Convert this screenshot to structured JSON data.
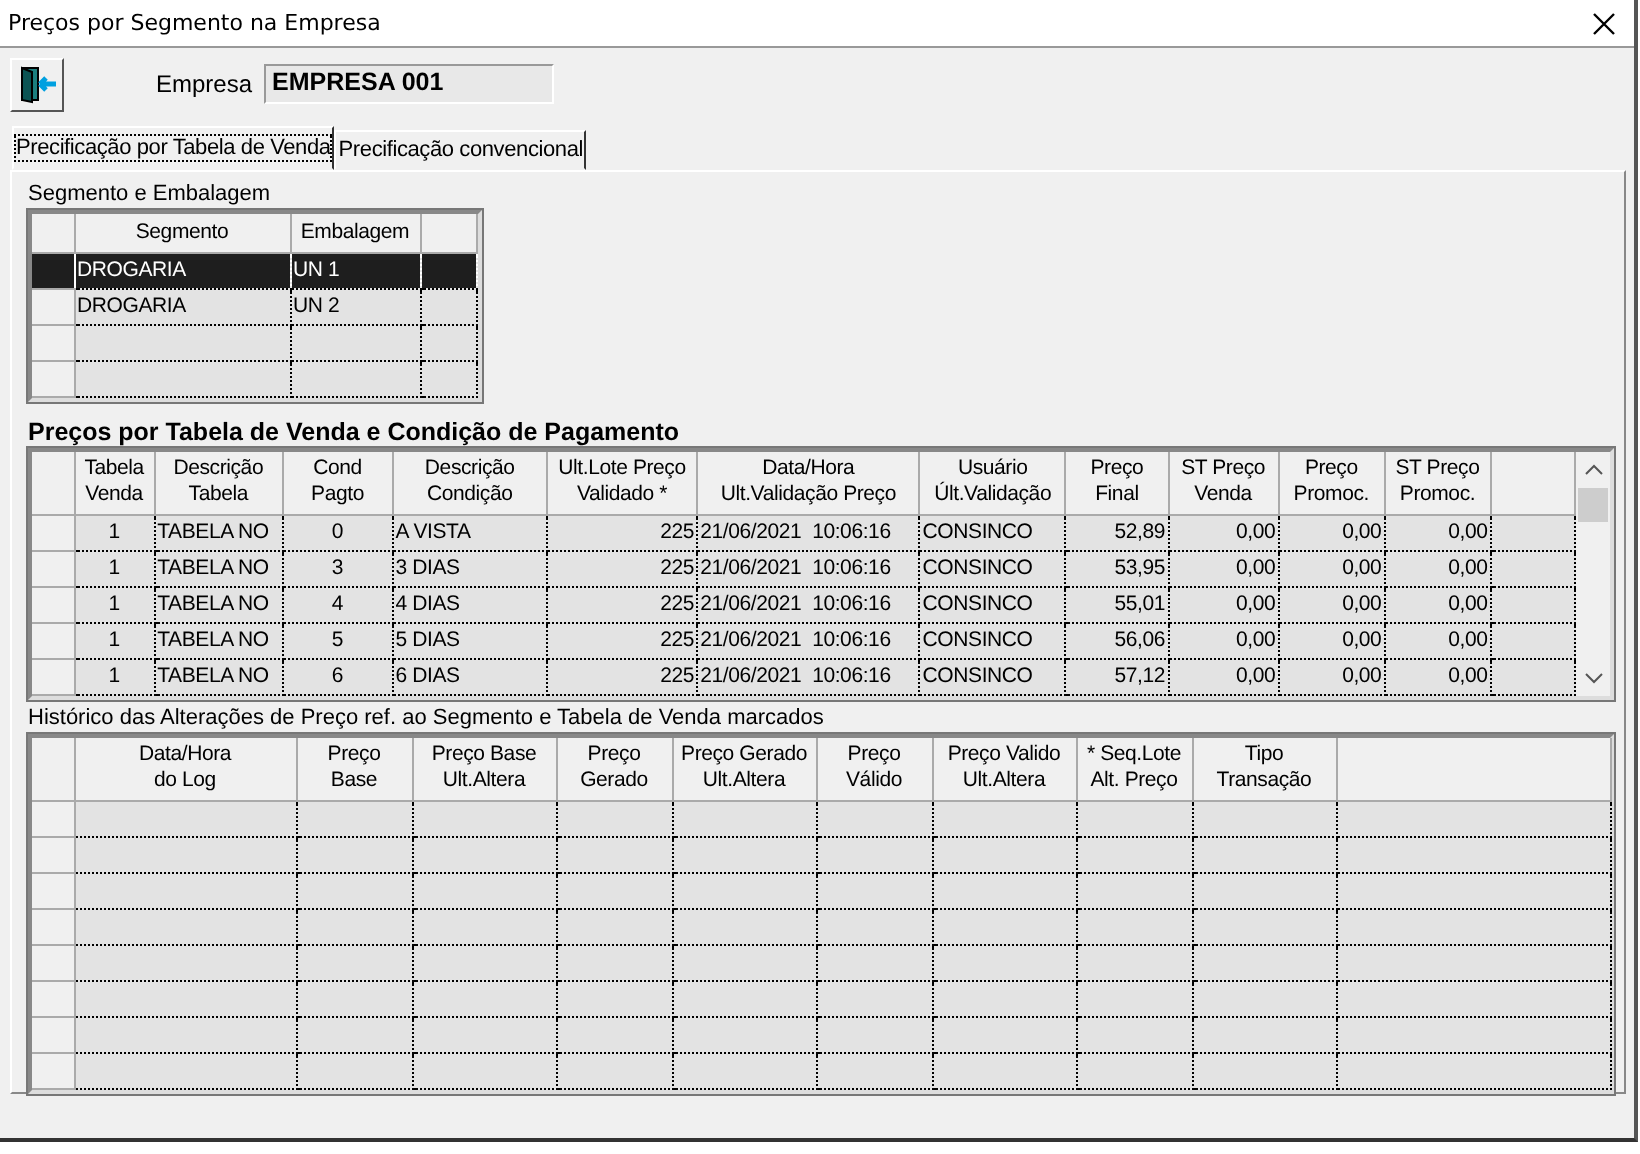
{
  "window": {
    "title": "Preços por Segmento na Empresa"
  },
  "empresa": {
    "label": "Empresa",
    "value": "EMPRESA 001"
  },
  "tabs": [
    {
      "label": "Precificação por Tabela de Venda",
      "selected": true
    },
    {
      "label": "Precificação convencional",
      "selected": false
    }
  ],
  "segmento_grid": {
    "title": "Segmento e Embalagem",
    "columns": [
      "Segmento",
      "Embalagem"
    ],
    "rows": [
      {
        "cells": [
          "DROGARIA",
          "UN 1"
        ],
        "selected": true
      },
      {
        "cells": [
          "DROGARIA",
          "UN 2"
        ],
        "selected": false
      }
    ]
  },
  "precos_grid": {
    "title": "Preços por Tabela de Venda e Condição de Pagamento",
    "columns": [
      "Tabela\nVenda",
      "Descrição\nTabela",
      "Cond\nPagto",
      "Descrição\nCondição",
      "Ult.Lote Preço\nValidado *",
      "Data/Hora\nUlt.Validação Preço",
      "Usuário\nÚlt.Validação",
      "Preço\nFinal",
      "ST Preço\nVenda",
      "Preço\nPromoc.",
      "ST Preço\nPromoc."
    ],
    "rows": [
      {
        "cells": [
          "1",
          "TABELA NO",
          "0",
          "A VISTA",
          "225",
          "21/06/2021  10:06:16",
          "CONSINCO",
          "52,89",
          "0,00",
          "0,00",
          "0,00"
        ],
        "selected": false
      },
      {
        "cells": [
          "1",
          "TABELA NO",
          "3",
          "3 DIAS",
          "225",
          "21/06/2021  10:06:16",
          "CONSINCO",
          "53,95",
          "0,00",
          "0,00",
          "0,00"
        ],
        "selected": false
      },
      {
        "cells": [
          "1",
          "TABELA NO",
          "4",
          "4 DIAS",
          "225",
          "21/06/2021  10:06:16",
          "CONSINCO",
          "55,01",
          "0,00",
          "0,00",
          "0,00"
        ],
        "selected": false
      },
      {
        "cells": [
          "1",
          "TABELA NO",
          "5",
          "5 DIAS",
          "225",
          "21/06/2021  10:06:16",
          "CONSINCO",
          "56,06",
          "0,00",
          "0,00",
          "0,00"
        ],
        "selected": false
      },
      {
        "cells": [
          "1",
          "TABELA NO",
          "6",
          "6 DIAS",
          "225",
          "21/06/2021  10:06:16",
          "CONSINCO",
          "57,12",
          "0,00",
          "0,00",
          "0,00"
        ],
        "selected": false
      }
    ]
  },
  "historico_grid": {
    "title": "Histórico das Alterações de Preço ref. ao Segmento e Tabela de Venda marcados",
    "columns": [
      "Data/Hora\ndo Log",
      "Preço\nBase",
      "Preço Base\nUlt.Altera",
      "Preço\nGerado",
      "Preço Gerado\nUlt.Altera",
      "Preço\nVálido",
      "Preço Valido\nUlt.Altera",
      "* Seq.Lote\nAlt. Preço",
      "Tipo\nTransação"
    ]
  }
}
